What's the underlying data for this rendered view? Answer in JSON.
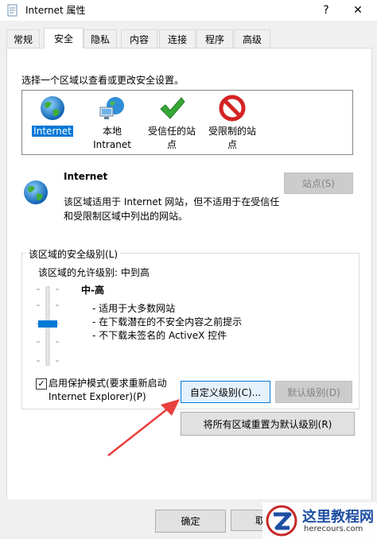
{
  "window": {
    "title": "Internet 属性",
    "help_glyph": "?",
    "close_glyph": "✕"
  },
  "tabs": [
    {
      "label": "常规"
    },
    {
      "label": "安全"
    },
    {
      "label": "隐私"
    },
    {
      "label": "内容"
    },
    {
      "label": "连接"
    },
    {
      "label": "程序"
    },
    {
      "label": "高级"
    }
  ],
  "security": {
    "instruction": "选择一个区域以查看或更改安全设置。",
    "zones": [
      {
        "label": "Internet",
        "icon": "globe-icon",
        "selected": true
      },
      {
        "label_line1": "本地",
        "label_line2": "Intranet",
        "icon": "intranet-icon"
      },
      {
        "label_line1": "受信任的站",
        "label_line2": "点",
        "icon": "checkmark-icon"
      },
      {
        "label_line1": "受限制的站",
        "label_line2": "点",
        "icon": "restricted-icon"
      }
    ],
    "zone_title": "Internet",
    "zone_desc_line1": "该区域适用于 Internet 网站，但不适用于在受信任",
    "zone_desc_line2": "和受限制区域中列出的网站。",
    "sites_button": "站点(S)",
    "level_group_label": "该区域的安全级别(L)",
    "allowed_levels": "该区域的允许级别: 中到高",
    "level_name": "中-高",
    "level_bullets": [
      "- 适用于大多数网站",
      "- 在下载潜在的不安全内容之前提示",
      "- 不下载未签名的 ActiveX 控件"
    ],
    "protected_mode_line1": "启用保护模式(要求重新启动",
    "protected_mode_line2": "Internet Explorer)(P)",
    "protected_mode_checked": "✓",
    "custom_level_button": "自定义级别(C)...",
    "default_level_button": "默认级别(D)",
    "reset_all_button": "将所有区域重置为默认级别(R)"
  },
  "footer": {
    "ok_button": "确定",
    "cancel_partial": "取"
  },
  "watermark": {
    "name": "这里教程网",
    "url": "herecours.com"
  },
  "colors": {
    "selection": "#0078d7",
    "arrow": "#e8403d"
  }
}
